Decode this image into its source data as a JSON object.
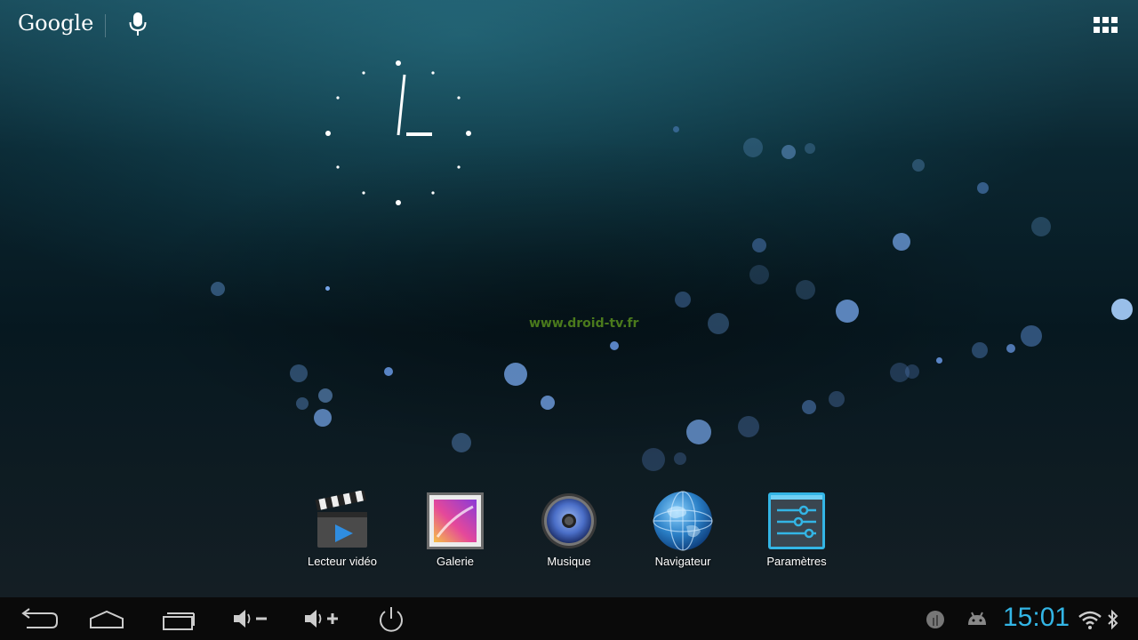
{
  "topbar": {
    "search_label": "Google"
  },
  "watermark": "www.droid-tv.fr",
  "dock": {
    "items": [
      {
        "label": "Lecteur vidéo",
        "icon": "video-player-icon"
      },
      {
        "label": "Galerie",
        "icon": "gallery-icon"
      },
      {
        "label": "Musique",
        "icon": "music-icon"
      },
      {
        "label": "Navigateur",
        "icon": "browser-globe-icon"
      },
      {
        "label": "Paramètres",
        "icon": "settings-icon"
      }
    ]
  },
  "navbar": {
    "buttons": [
      "back-icon",
      "home-icon",
      "recent-apps-icon",
      "volume-down-icon",
      "volume-up-icon",
      "power-icon"
    ]
  },
  "status": {
    "time": "15:01",
    "icons": [
      "notification-icon",
      "android-debug-icon",
      "wifi-icon",
      "bluetooth-icon"
    ]
  },
  "colors": {
    "accent": "#33b5e5",
    "navbar": "#0a0a0a"
  }
}
